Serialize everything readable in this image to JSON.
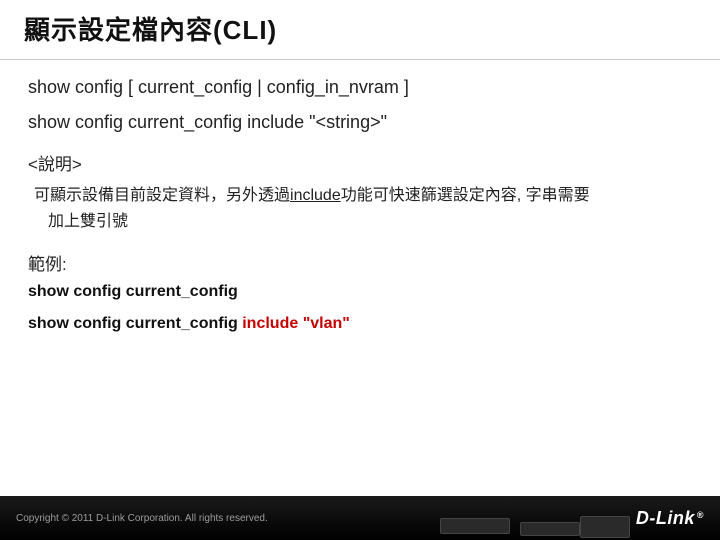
{
  "title": "顯示設定檔內容(CLI)",
  "syntax1": "show config [ current_config | config_in_nvram  ]",
  "syntax2": "show config current_config include \"<string>\"",
  "section_label": "<說明>",
  "desc_prefix": "可顯示設備目前設定資料，另外透過",
  "desc_underlined": "include",
  "desc_suffix": "功能可快速篩選設定內容, 字串需要",
  "desc_line2": "加上雙引號",
  "example_label": "範例:",
  "example1": "show config current_config",
  "example2_prefix": "show config current_config ",
  "example2_red": "include \"vlan\"",
  "footer": {
    "copyright": "Copyright © 2011 D-Link Corporation. All rights reserved.",
    "logo_text": "D-Link",
    "logo_reg": "®"
  }
}
